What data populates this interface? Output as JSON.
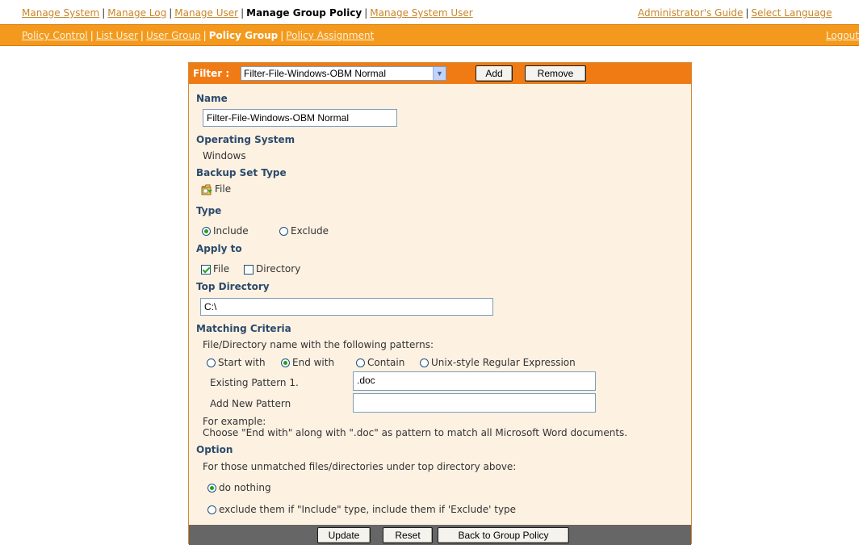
{
  "top_nav": {
    "items": [
      "Manage System",
      "Manage Log",
      "Manage User",
      "Manage Group Policy",
      "Manage System User"
    ],
    "active": "Manage Group Policy",
    "right_items": [
      "Administrator's Guide",
      "Select Language"
    ]
  },
  "sub_nav": {
    "items": [
      "Policy Control",
      "List User",
      "User Group",
      "Policy Group",
      "Policy Assignment"
    ],
    "active": "Policy Group",
    "logout": "Logout"
  },
  "filter_bar": {
    "label": "Filter :",
    "selected": "Filter-File-Windows-OBM Normal",
    "add_label": "Add",
    "remove_label": "Remove"
  },
  "form": {
    "name_label": "Name",
    "name_value": "Filter-File-Windows-OBM Normal",
    "os_label": "Operating System",
    "os_value": "Windows",
    "backup_set_type_label": "Backup Set Type",
    "backup_set_type_value": "File",
    "type_label": "Type",
    "type_options": [
      "Include",
      "Exclude"
    ],
    "type_selected": "Include",
    "apply_to_label": "Apply to",
    "apply_file": "File",
    "apply_file_checked": true,
    "apply_directory": "Directory",
    "apply_directory_checked": false,
    "top_directory_label": "Top Directory",
    "top_directory_value": "C:\\",
    "matching_criteria_label": "Matching Criteria",
    "matching_desc": "File/Directory name with the following patterns:",
    "match_options": [
      "Start with",
      "End with",
      "Contain",
      "Unix-style Regular Expression"
    ],
    "match_selected": "End with",
    "existing_pattern_label": "Existing Pattern 1.",
    "existing_pattern_value": ".doc",
    "add_pattern_label": "Add New Pattern",
    "add_pattern_value": "",
    "example_title": "For example:",
    "example_text": "Choose \"End with\" along with \".doc\" as pattern to match all Microsoft Word documents.",
    "option_label": "Option",
    "option_desc": "For those unmatched files/directories under top directory above:",
    "option_do_nothing": "do nothing",
    "option_exclude": "exclude them if \"Include\" type, include them if 'Exclude' type",
    "option_selected": "do nothing"
  },
  "footer": {
    "update_label": "Update",
    "reset_label": "Reset",
    "back_label": "Back to Group Policy"
  },
  "colors": {
    "accent_orange": "#f39a1e",
    "filter_bar": "#f07b14",
    "panel_bg": "#fdf1e2",
    "label_blue": "#2b4a6b",
    "footer_gray": "#666666"
  }
}
